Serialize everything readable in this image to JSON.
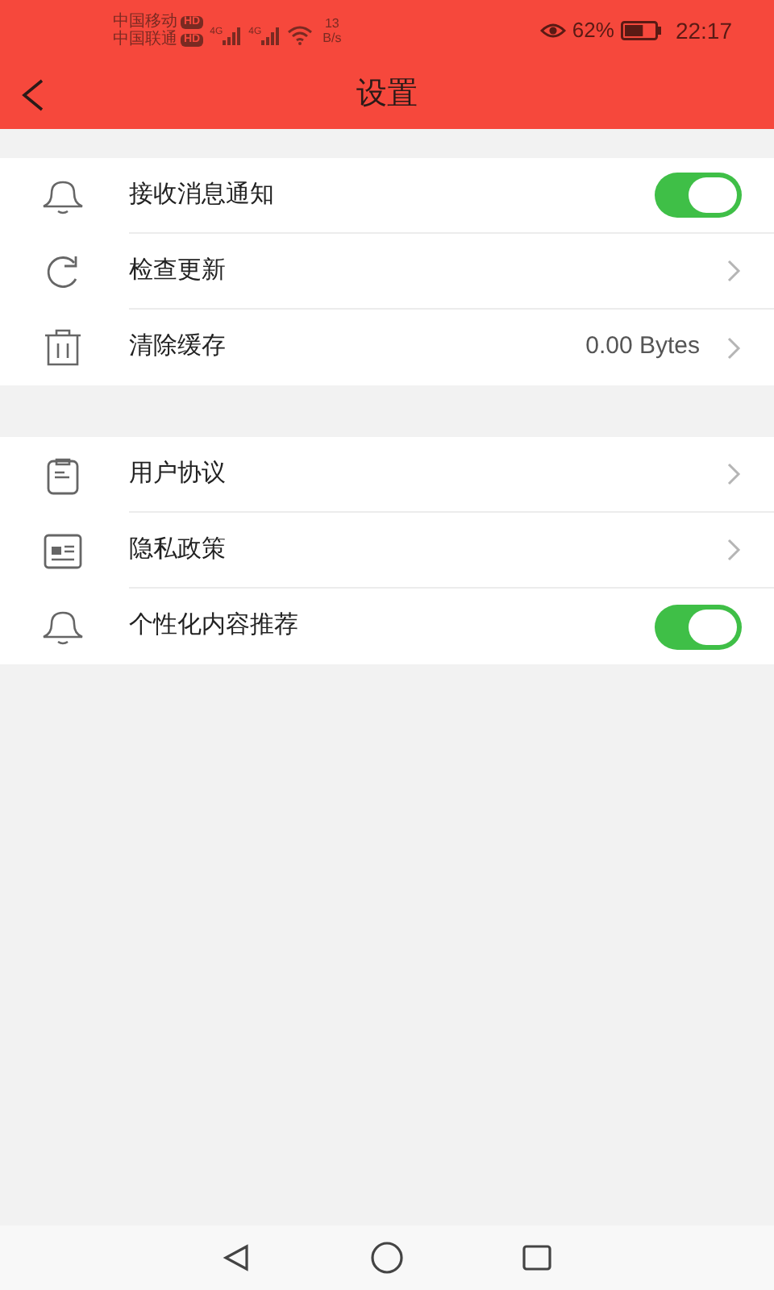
{
  "status_bar": {
    "carriers": [
      {
        "name": "中国移动",
        "badge": "HD"
      },
      {
        "name": "中国联通",
        "badge": "HD"
      }
    ],
    "network_labels": [
      "4G",
      "4G"
    ],
    "speed": {
      "value": "13",
      "unit": "B/s"
    },
    "battery": {
      "percent": "62%",
      "level": 0.62
    },
    "time": "22:17"
  },
  "header": {
    "title": "设置"
  },
  "groups": [
    {
      "items": [
        {
          "label": "接收消息通知",
          "kind": "toggle",
          "on": true
        },
        {
          "label": "检查更新",
          "kind": "link"
        },
        {
          "label": "清除缓存",
          "kind": "link",
          "value": "0.00 Bytes"
        }
      ]
    },
    {
      "items": [
        {
          "label": "用户协议",
          "kind": "link"
        },
        {
          "label": "隐私政策",
          "kind": "link"
        },
        {
          "label": "个性化内容推荐",
          "kind": "toggle",
          "on": true
        }
      ]
    }
  ]
}
